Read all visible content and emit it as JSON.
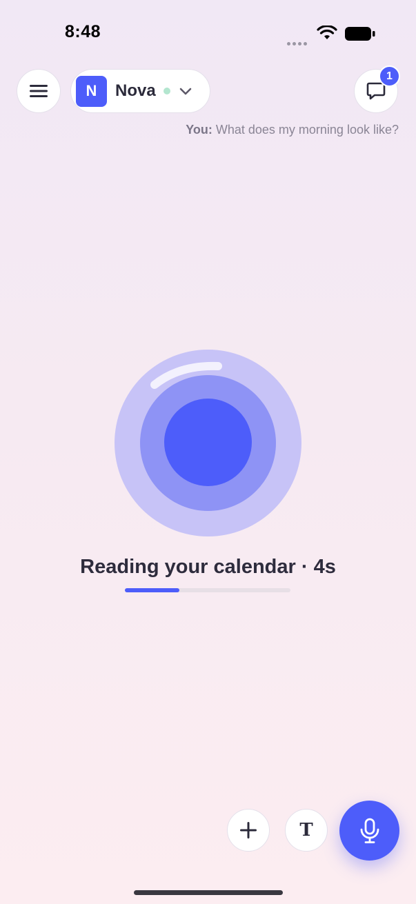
{
  "status_bar": {
    "time": "8:48"
  },
  "header": {
    "agent": {
      "initial": "N",
      "name": "Nova",
      "online_color": "#b3e6cf"
    },
    "chat_badge_count": "1"
  },
  "transcript": {
    "speaker": "You:",
    "text": " What does my morning look like?"
  },
  "activity": {
    "status_text": "Reading your calendar · 4s",
    "progress_percent": 33
  },
  "controls": {
    "text_mode_glyph": "T"
  },
  "icons": {
    "menu": "hamburger-icon",
    "chat": "chat-bubble-icon",
    "add": "plus-icon",
    "mic": "microphone-icon",
    "chevron": "chevron-down-icon"
  },
  "colors": {
    "accent": "#4d5dfa",
    "orb_outer": "#c7c3f7",
    "orb_mid": "#8e93f5"
  }
}
